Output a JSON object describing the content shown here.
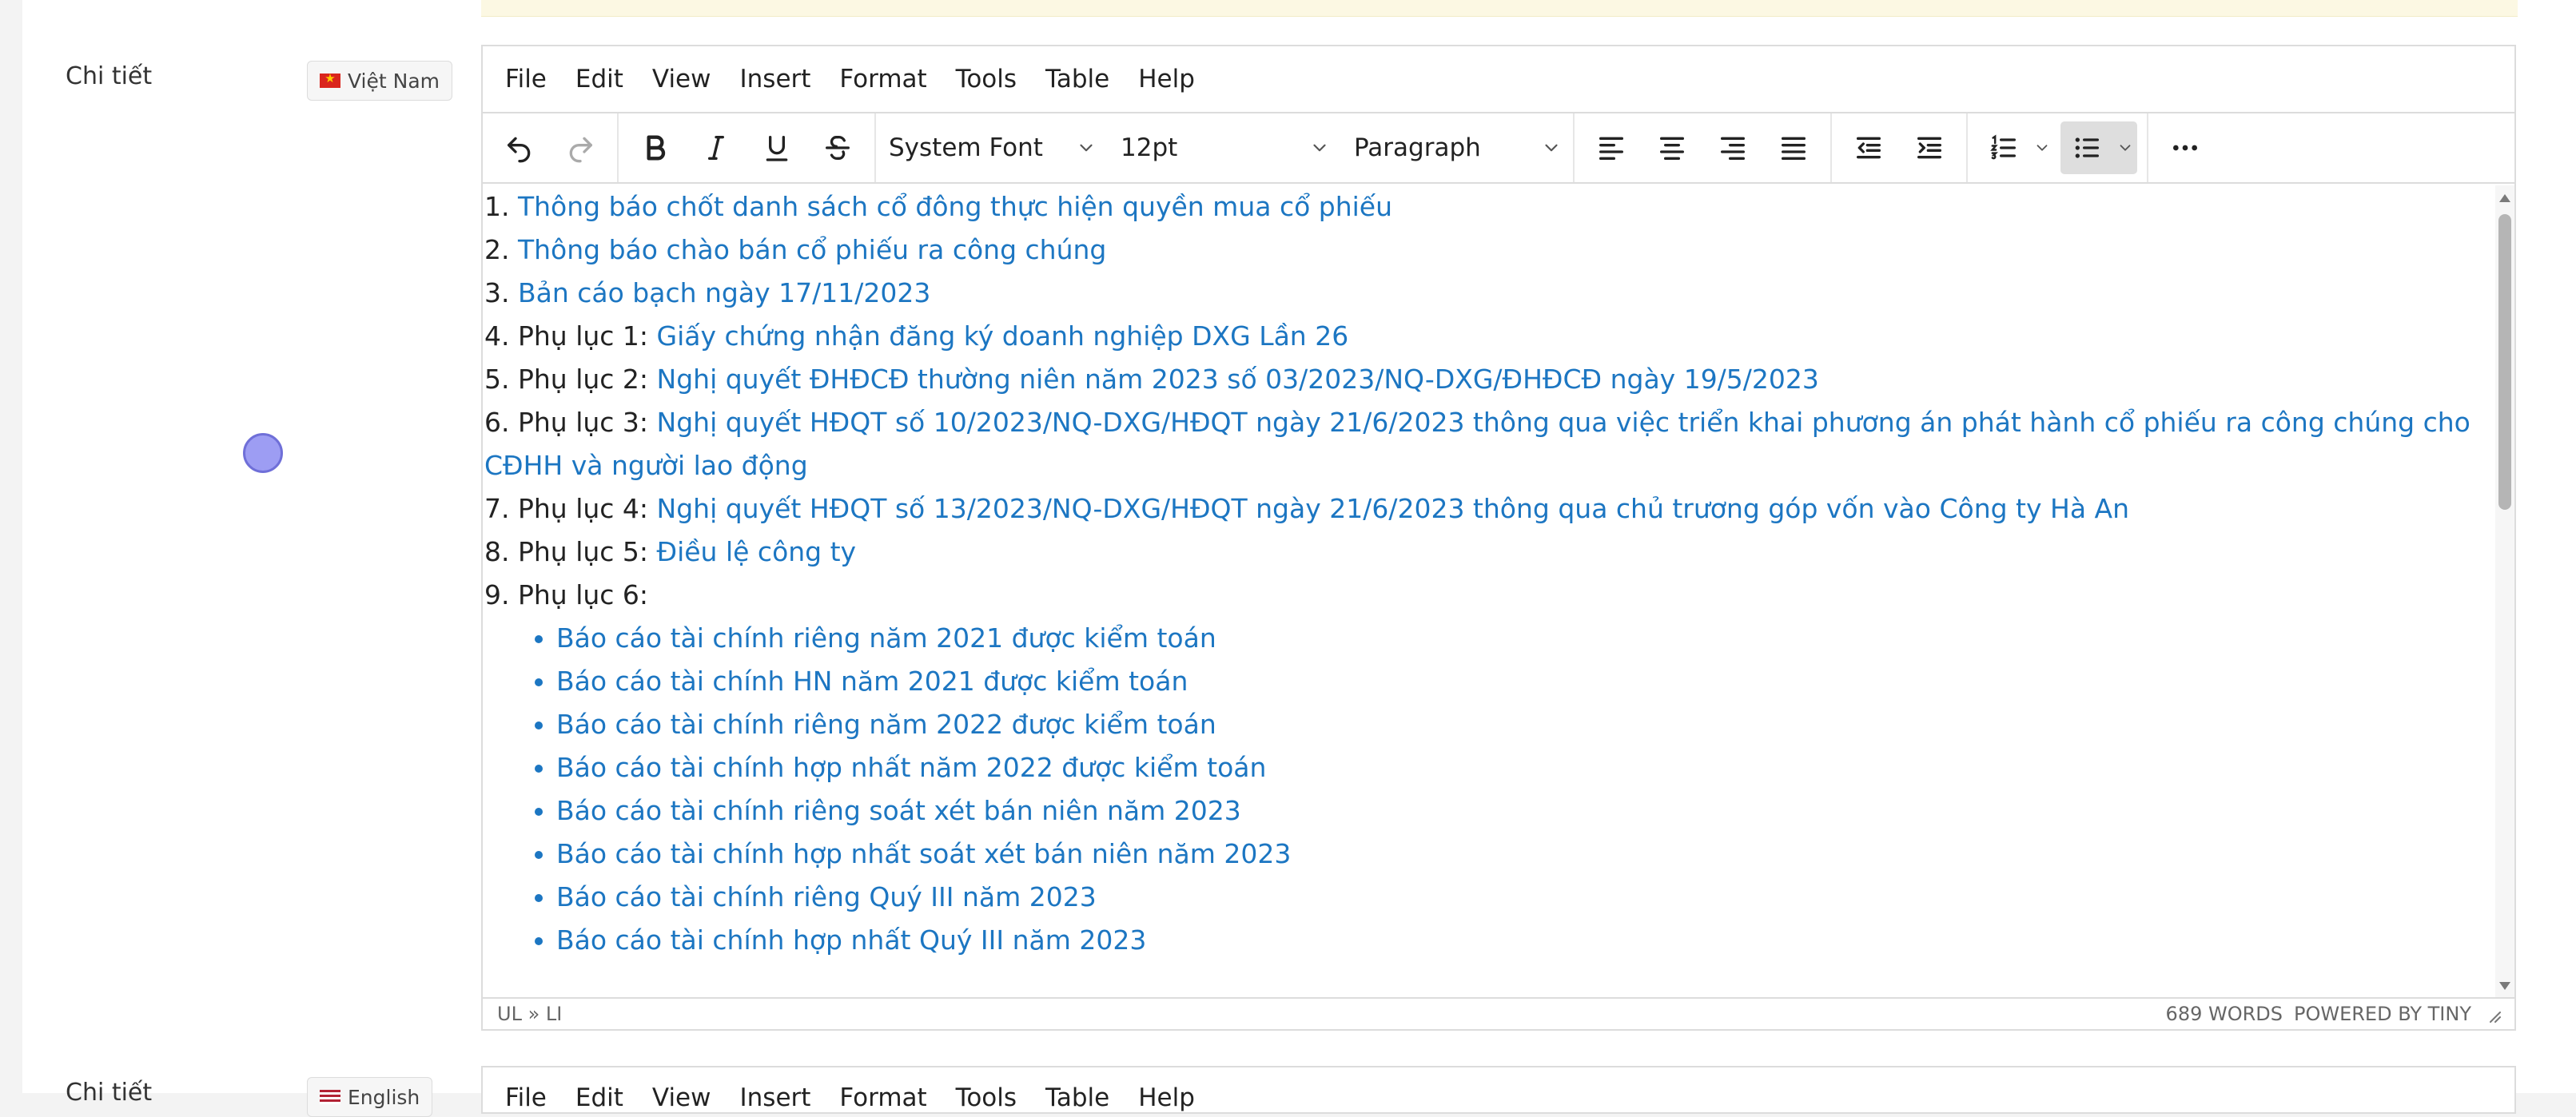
{
  "fields": [
    {
      "label": "Chi tiết",
      "language": "Việt Nam"
    },
    {
      "label": "Chi tiết",
      "language": "English"
    }
  ],
  "editor": {
    "menu": [
      "File",
      "Edit",
      "View",
      "Insert",
      "Format",
      "Tools",
      "Table",
      "Help"
    ],
    "toolbar": {
      "undo": "undo-icon",
      "redo": "redo-icon",
      "bold": "bold-icon",
      "italic": "italic-icon",
      "underline": "underline-icon",
      "strikethrough": "strikethrough-icon",
      "font_family": "System Font",
      "font_size": "12pt",
      "block_format": "Paragraph",
      "align": [
        "align-left-icon",
        "align-center-icon",
        "align-right-icon",
        "align-justify-icon"
      ],
      "indent": [
        "outdent-icon",
        "indent-icon"
      ],
      "lists": [
        "numbered-list-icon",
        "bullet-list-icon"
      ],
      "bullet_list_active": true,
      "more": "more-icon"
    },
    "content": {
      "items": [
        {
          "prefix": "1. ",
          "link": "Thông báo chốt danh sách cổ đông thực hiện quyền mua cổ phiếu"
        },
        {
          "prefix": "2. ",
          "link": "Thông báo chào bán cổ phiếu ra công chúng"
        },
        {
          "prefix": "3. ",
          "link": "Bản cáo bạch ngày 17/11/2023"
        },
        {
          "prefix": "4. Phụ lục 1: ",
          "link": "Giấy chứng nhận đăng ký doanh nghiệp DXG Lần 26"
        },
        {
          "prefix": "5. Phụ lục 2: ",
          "link": "Nghị quyết ĐHĐCĐ thường niên năm 2023 số 03/2023/NQ-DXG/ĐHĐCĐ ngày 19/5/2023"
        },
        {
          "prefix": "6. Phụ lục 3: ",
          "link": "Nghị quyết HĐQT số 10/2023/NQ-DXG/HĐQT ngày 21/6/2023 thông qua việc triển khai phương án phát hành cổ phiếu ra công chúng cho CĐHH và người lao động"
        },
        {
          "prefix": "7. Phụ lục 4: ",
          "link": "Nghị quyết HĐQT số 13/2023/NQ-DXG/HĐQT ngày 21/6/2023 thông qua chủ trương góp vốn vào Công ty Hà An"
        },
        {
          "prefix": "8. Phụ lục 5: ",
          "link": "Điều lệ công ty"
        },
        {
          "prefix": "9. Phụ lục 6:",
          "link": ""
        }
      ],
      "sub_items": [
        "Báo cáo tài chính riêng năm 2021 được kiểm toán",
        "Báo cáo tài chính HN năm 2021 được kiểm toán",
        "Báo cáo tài chính riêng năm 2022 được kiểm toán",
        "Báo cáo tài chính hợp nhất năm 2022 được kiểm toán",
        "Báo cáo tài chính riêng soát xét bán niên năm 2023",
        "Báo cáo tài chính hợp nhất soát xét bán niên năm 2023",
        "Báo cáo tài chính riêng Quý III năm 2023",
        "Báo cáo tài chính hợp nhất Quý III năm 2023"
      ]
    },
    "status": {
      "path": "UL » LI",
      "word_count": "689 WORDS",
      "branding": "POWERED BY TINY"
    }
  },
  "colors": {
    "link": "#1c76c2",
    "notice_background": "#fcf8e3",
    "active_button": "#dedede",
    "cursor": "#9d9df3"
  }
}
